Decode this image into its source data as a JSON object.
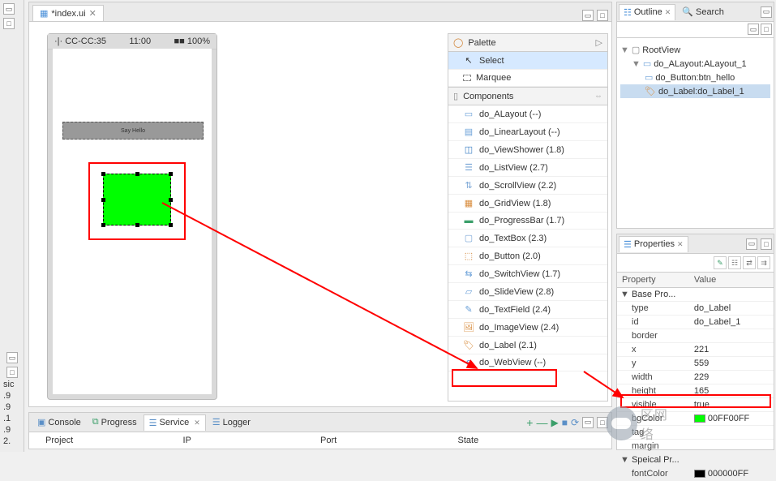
{
  "editor": {
    "filename": "*index.ui"
  },
  "device": {
    "statusLeft": "·|· CC-CC:35",
    "statusCenter": "11:00",
    "statusRight": "■■ 100%",
    "buttonText": "Say Hello"
  },
  "palette": {
    "title": "Palette",
    "tools": {
      "select": "Select",
      "marquee": "Marquee"
    },
    "section": "Components",
    "items": [
      {
        "label": "do_ALayout (--)"
      },
      {
        "label": "do_LinearLayout (--)"
      },
      {
        "label": "do_ViewShower (1.8)"
      },
      {
        "label": "do_ListView (2.7)"
      },
      {
        "label": "do_ScrollView (2.2)"
      },
      {
        "label": "do_GridView (1.8)"
      },
      {
        "label": "do_ProgressBar (1.7)"
      },
      {
        "label": "do_TextBox (2.3)"
      },
      {
        "label": "do_Button (2.0)"
      },
      {
        "label": "do_SwitchView (1.7)"
      },
      {
        "label": "do_SlideView (2.8)"
      },
      {
        "label": "do_TextField (2.4)"
      },
      {
        "label": "do_ImageView (2.4)"
      },
      {
        "label": "do_Label (2.1)"
      },
      {
        "label": "do_WebView (--)"
      }
    ]
  },
  "outline": {
    "tab1": "Outline",
    "tab2": "Search",
    "root": "RootView",
    "layout": "do_ALayout:ALayout_1",
    "btn": "do_Button:btn_hello",
    "label": "do_Label:do_Label_1"
  },
  "props": {
    "title": "Properties",
    "colProperty": "Property",
    "colValue": "Value",
    "groupBase": "Base Pro...",
    "rows": {
      "type": {
        "k": "type",
        "v": "do_Label"
      },
      "id": {
        "k": "id",
        "v": "do_Label_1"
      },
      "border": {
        "k": "border",
        "v": ""
      },
      "x": {
        "k": "x",
        "v": "221"
      },
      "y": {
        "k": "y",
        "v": "559"
      },
      "width": {
        "k": "width",
        "v": "229"
      },
      "height": {
        "k": "height",
        "v": "165"
      },
      "visible": {
        "k": "visible",
        "v": "true"
      },
      "bgColor": {
        "k": "bgColor",
        "v": "00FF00FF"
      },
      "tag": {
        "k": "tag",
        "v": ""
      },
      "margin": {
        "k": "margin",
        "v": ""
      }
    },
    "groupSpecial": "Speical Pr...",
    "fontColor": {
      "k": "fontColor",
      "v": "000000FF"
    }
  },
  "bottom": {
    "tabs": {
      "console": "Console",
      "progress": "Progress",
      "service": "Service",
      "logger": "Logger"
    },
    "cols": {
      "project": "Project",
      "ip": "IP",
      "port": "Port",
      "state": "State"
    }
  },
  "leftSliver": {
    "label": "sic",
    "nums": [
      ".9",
      ".9",
      ".1",
      ".9",
      "2."
    ]
  }
}
